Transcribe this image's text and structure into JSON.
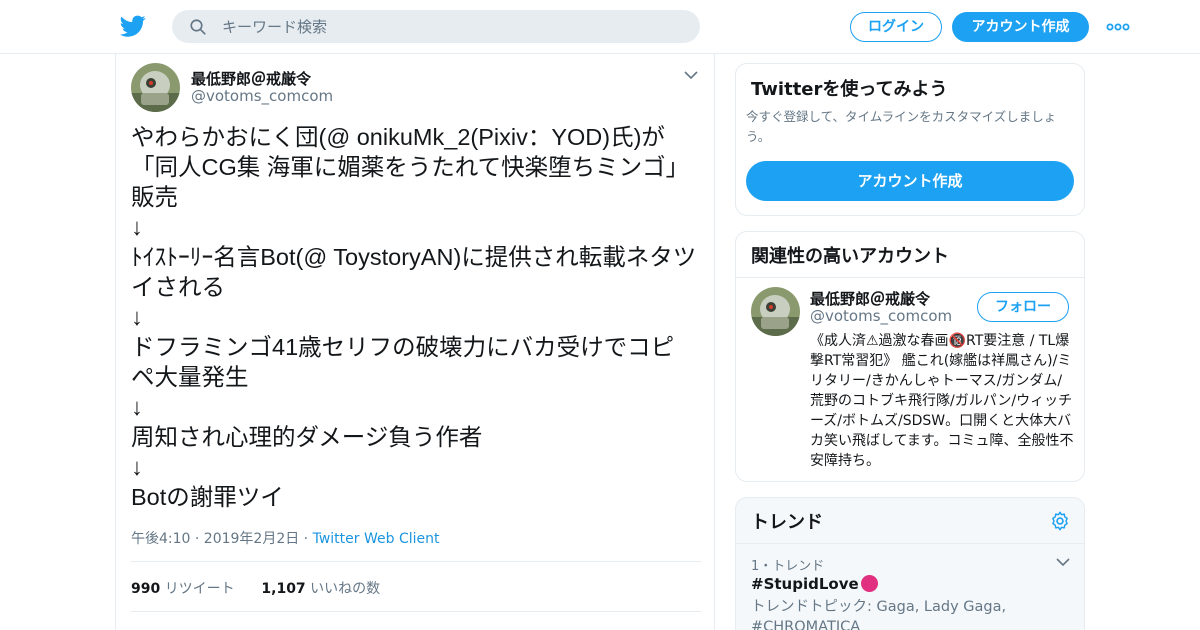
{
  "header": {
    "search_placeholder": "キーワード検索",
    "login_label": "ログイン",
    "signup_label": "アカウント作成",
    "brand_color": "#1da1f2"
  },
  "tweet": {
    "author_name": "最低野郎＠戒厳令",
    "author_handle": "@votoms_comcom",
    "lines": [
      "やわらかおにく団(@ onikuMk_2(Pixiv：YOD)氏)が",
      "「同人CG集 海軍に媚薬をうたれて快楽堕ちミンゴ」",
      "販売",
      "↓",
      "ﾄｲｽﾄｰﾘｰ名言Bot(@ ToystoryAN)に提供され転載ネタツ",
      "イされる",
      "↓",
      "ドフラミンゴ41歳セリフの破壊力にバカ受けでコピ",
      "ペ大量発生",
      "↓",
      "周知され心理的ダメージ負う作者",
      "↓",
      "Botの謝罪ツイ"
    ],
    "meta": "午後4:10 · 2019年2月2日 · ",
    "client": "Twitter Web Client",
    "retweet_count": "990",
    "retweet_label": "リツイート",
    "like_count": "1,107",
    "like_label": "いいねの数"
  },
  "sidebar": {
    "try_card": {
      "title": "Twitterを使ってみよう",
      "description": "今すぐ登録して、タイムラインをカスタマイズしましょう。",
      "cta_label": "アカウント作成"
    },
    "related_card": {
      "title": "関連性の高いアカウント",
      "name": "最低野郎＠戒厳令",
      "handle": "@votoms_comcom",
      "follow_label": "フォロー",
      "bio": "《成人済⚠過激な春画🔞RT要注意 / TL爆撃RT常習犯》 艦これ(嫁艦は祥鳳さん)/ミリタリー/きかんしゃトーマス/ガンダム/荒野のコトブキ飛行隊/ガルパン/ウィッチーズ/ボトムズ/SDSW。口開くと大体大バカ笑い飛ばしてます。コミュ障、全般性不安障持ち。"
    },
    "trends_card": {
      "title": "トレンド",
      "rank_label": "1・トレンド",
      "hashtag": "#StupidLove",
      "topic": "トレンドトピック: Gaga, Lady Gaga, #CHROMATICA"
    }
  }
}
